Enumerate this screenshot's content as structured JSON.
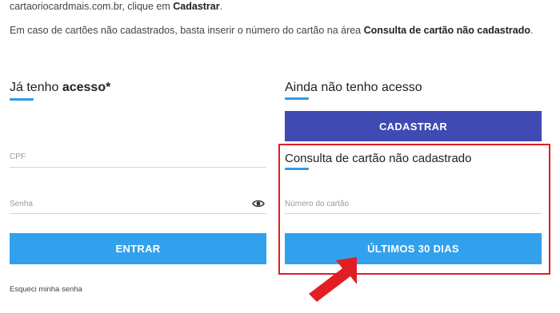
{
  "intro": {
    "line1_prefix": "cartaoriocardmais.com.br, clique em ",
    "line1_bold": "Cadastrar",
    "line1_suffix": ".",
    "line2_prefix": "Em caso de cartões não cadastrados, basta inserir o número do cartão na área ",
    "line2_bold": "Consulta de cartão não cadastrado",
    "line2_suffix": "."
  },
  "login": {
    "title_prefix": "Já tenho ",
    "title_bold": "acesso*",
    "cpf_placeholder": "CPF",
    "password_placeholder": "Senha",
    "submit_label": "ENTRAR",
    "forgot_link": "Esqueci minha senha"
  },
  "signup": {
    "title": "Ainda não tenho acesso",
    "register_label": "CADASTRAR"
  },
  "card_lookup": {
    "title": "Consulta de cartão não cadastrado",
    "card_number_placeholder": "Número do cartão",
    "submit_label": "ÚLTIMOS 30 DIAS"
  },
  "colors": {
    "accent_blue": "#33a0ee",
    "register_indigo": "#3f4bb3",
    "highlight_red": "#e01e24"
  },
  "icons": {
    "password_toggle": "eye-icon",
    "pointer": "arrow-icon"
  }
}
